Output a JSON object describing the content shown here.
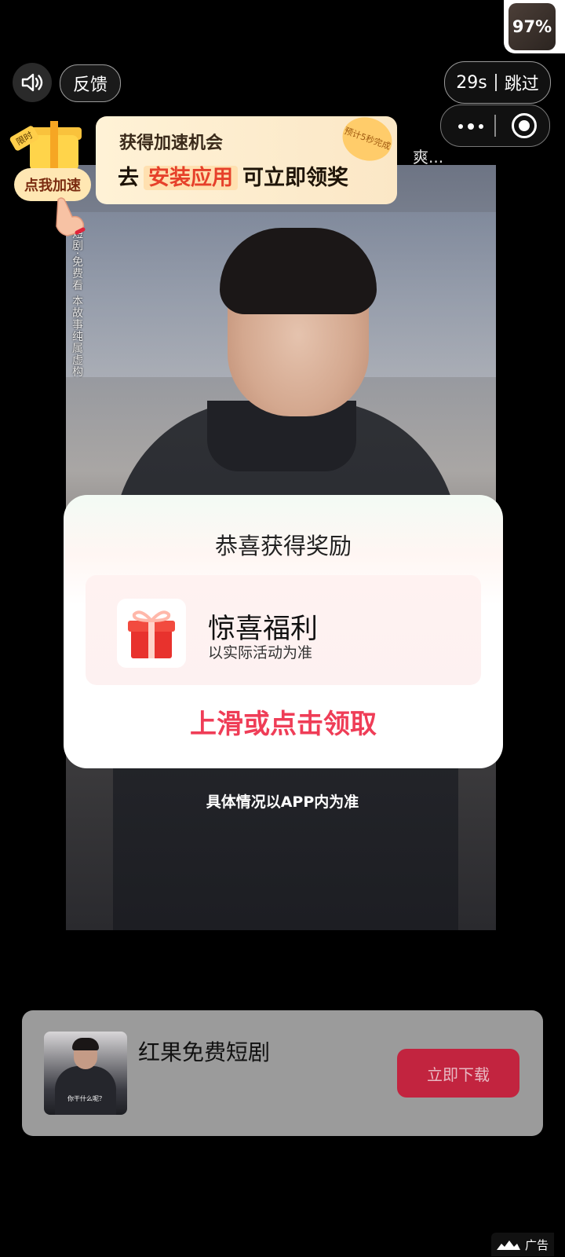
{
  "top_left": {
    "sound_icon": "speaker-icon",
    "feedback_label": "反馈"
  },
  "top_right": {
    "battery_percent": "97%",
    "skip_countdown": "29s",
    "skip_label": "跳过"
  },
  "speed_banner": {
    "title": "获得加速机会",
    "line_prefix": "去",
    "line_highlight": "安装应用",
    "line_suffix": "可立即领奖",
    "badge": "预计5秒完成",
    "limited_tag": "限时",
    "speed_up_button": "点我加速"
  },
  "video": {
    "side_text": "短剧·免费看 本故事纯属虚构",
    "top_caption": "爽..."
  },
  "reward_modal": {
    "title": "恭喜获得奖励",
    "reward_name": "惊喜福利",
    "reward_sub": "以实际活动为准",
    "claim_text": "上滑或点击领取"
  },
  "notice": "具体情况以APP内为准",
  "app_card": {
    "app_name": "红果免费短剧",
    "thumb_caption": "你干什么呢？",
    "download_label": "立即下载"
  },
  "ad_badge": "广告",
  "colors": {
    "claim": "#ef3d57",
    "download_button": "#c2243f",
    "highlight": "#e6402a"
  }
}
